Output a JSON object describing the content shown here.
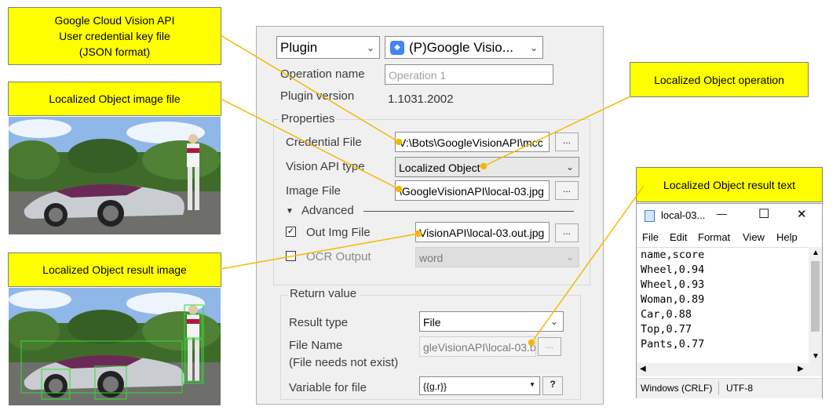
{
  "callouts": {
    "credential": [
      "Google Cloud Vision API",
      "User credential key file",
      "(JSON format)"
    ],
    "image_file": "Localized Object image file",
    "operation": "Localized Object operation",
    "result_text": "Localized Object result text",
    "result_image": "Localized Object result image"
  },
  "plugin_panel": {
    "plugin_select": "Plugin",
    "plugin_name": "(P)Google Visio...",
    "operation_name_label": "Operation name",
    "operation_name_placeholder": "Operation 1",
    "plugin_version_label": "Plugin version",
    "plugin_version": "1.1031.2002",
    "properties_title": "Properties",
    "credential_label": "Credential File",
    "credential_value": "V:\\Bots\\GoogleVisionAPI\\mcc",
    "vision_type_label": "Vision API type",
    "vision_type_value": "Localized Object",
    "image_file_label": "Image File",
    "image_file_value": "\\GoogleVisionAPI\\local-03.jpg",
    "advanced_label": "Advanced",
    "out_img_label": "Out Img File",
    "out_img_value": "VisionAPI\\local-03.out.jpg",
    "out_img_checked": true,
    "ocr_output_label": "OCR Output",
    "ocr_output_value": "word",
    "ocr_output_checked": false,
    "return_value_title": "Return value",
    "result_type_label": "Result type",
    "result_type_value": "File",
    "file_name_label": "File Name",
    "file_name_note": "(File needs not exist)",
    "file_name_value": "gleVisionAPI\\local-03.txt",
    "variable_label": "Variable for file",
    "variable_value": "{{g.r}}",
    "browse": "...",
    "help": "?"
  },
  "notepad": {
    "title": "local-03...",
    "menu": [
      "File",
      "Edit",
      "Format",
      "View",
      "Help"
    ],
    "lines": [
      "name,score",
      "Wheel,0.94",
      "Wheel,0.93",
      "Woman,0.89",
      "Car,0.88",
      "Top,0.77",
      "Pants,0.77"
    ],
    "status_eol": "Windows (CRLF)",
    "status_encoding": "UTF-8",
    "minimize": "—",
    "maximize": "☐",
    "close": "✕"
  },
  "colors": {
    "callout_yellow": "#ffff00",
    "leader_line": "#f5b800",
    "panel_bg": "#f0f0f0",
    "google_blue": "#4285f4"
  }
}
